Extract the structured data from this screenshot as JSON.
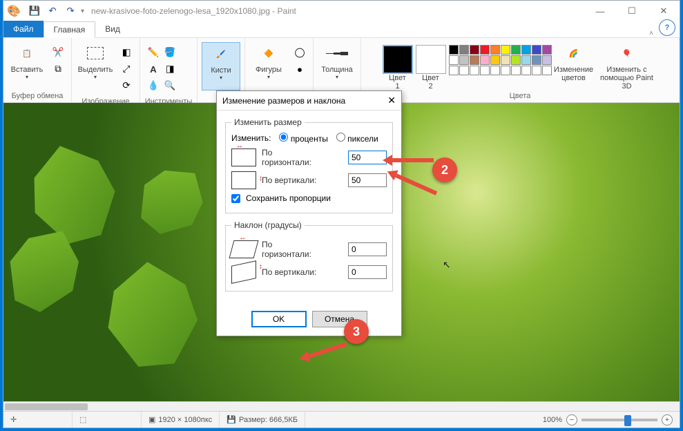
{
  "titlebar": {
    "filename": "new-krasivoe-foto-zelenogo-lesa_1920x1080.jpg - Paint"
  },
  "tabs": {
    "file": "Файл",
    "home": "Главная",
    "view": "Вид"
  },
  "ribbon": {
    "clipboard": {
      "paste": "Вставить",
      "label": "Буфер обмена"
    },
    "image": {
      "select": "Выделить",
      "label": "Изображение"
    },
    "tools_label": "Инструменты",
    "brushes": "Кисти",
    "shapes": "Фигуры",
    "thickness": "Толщина",
    "color1": "Цвет\n1",
    "color2": "Цвет\n2",
    "editcolors": "Изменение\nцветов",
    "open3d": "Изменить с\nпомощью Paint 3D",
    "colors_label": "Цвета"
  },
  "dialog": {
    "title": "Изменение размеров и наклона",
    "resize_legend": "Изменить размер",
    "by_label": "Изменить:",
    "percent": "проценты",
    "pixels": "пиксели",
    "horiz": "По\nгоризонтали:",
    "vert": "По вертикали:",
    "horiz_val": "50",
    "vert_val": "50",
    "keep_aspect": "Сохранить пропорции",
    "skew_legend": "Наклон (градусы)",
    "skew_h": "По\nгоризонтали:",
    "skew_v": "По вертикали:",
    "skew_h_val": "0",
    "skew_v_val": "0",
    "ok": "OK",
    "cancel": "Отмена"
  },
  "annotations": {
    "b2": "2",
    "b3": "3"
  },
  "status": {
    "dims": "1920 × 1080пкс",
    "size": "Размер: 666,5КБ",
    "zoom": "100%"
  },
  "palette_row1": [
    "#000",
    "#7f7f7f",
    "#880015",
    "#ed1c24",
    "#ff7f27",
    "#fff200",
    "#22b14c",
    "#00a2e8",
    "#3f48cc",
    "#a349a4"
  ],
  "palette_row2": [
    "#fff",
    "#c3c3c3",
    "#b97a57",
    "#ffaec9",
    "#ffc90e",
    "#efe4b0",
    "#b5e61d",
    "#99d9ea",
    "#7092be",
    "#c8bfe7"
  ]
}
